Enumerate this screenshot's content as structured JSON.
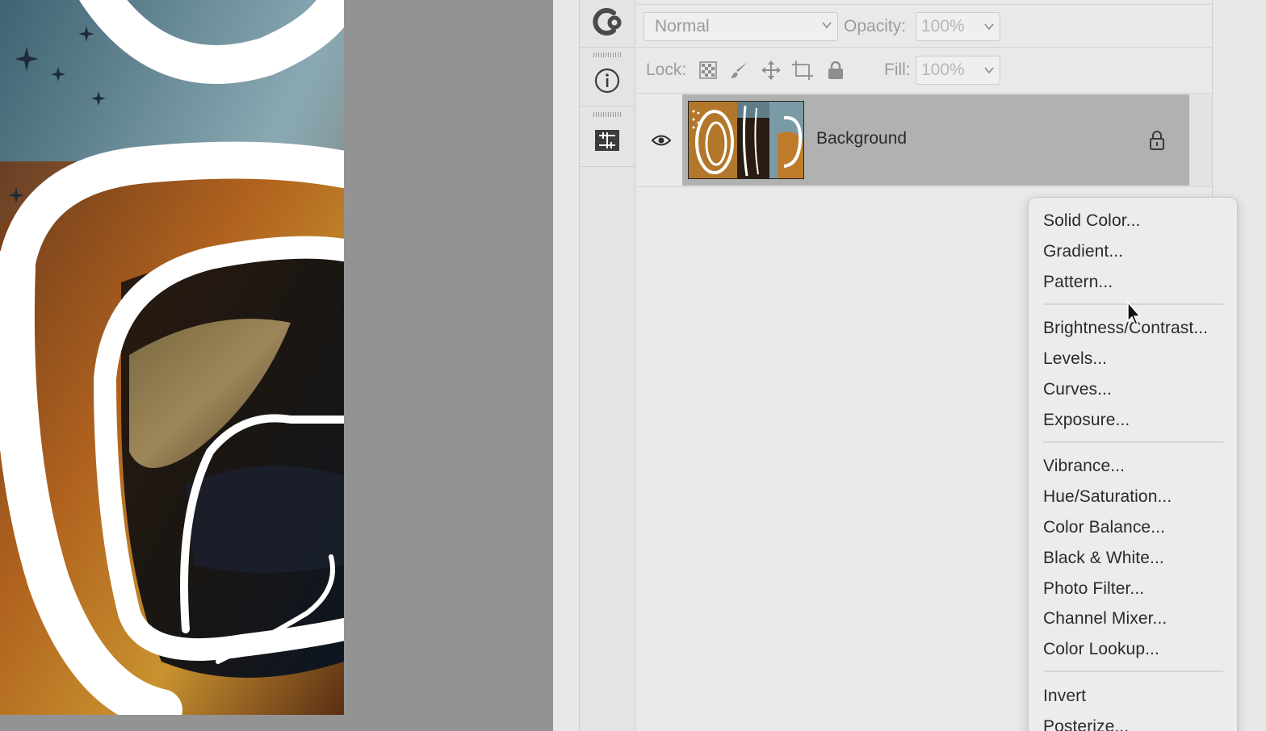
{
  "layers_panel": {
    "blend_mode": "Normal",
    "opacity_label": "Opacity:",
    "opacity_value": "100%",
    "lock_label": "Lock:",
    "fill_label": "Fill:",
    "fill_value": "100%",
    "layers": [
      {
        "name": "Background",
        "visible": true,
        "locked": true,
        "selected": true
      }
    ]
  },
  "context_menu": {
    "groups": [
      [
        "Solid Color...",
        "Gradient...",
        "Pattern..."
      ],
      [
        "Brightness/Contrast...",
        "Levels...",
        "Curves...",
        "Exposure..."
      ],
      [
        "Vibrance...",
        "Hue/Saturation...",
        "Color Balance...",
        "Black & White...",
        "Photo Filter...",
        "Channel Mixer...",
        "Color Lookup..."
      ],
      [
        "Invert",
        "Posterize..."
      ]
    ]
  },
  "icons": {
    "tool_1": "creative-cloud-libraries-icon",
    "tool_2": "info-icon",
    "tool_3": "properties-icon",
    "lock_icons": [
      "lock-transparent-pixels-icon",
      "lock-image-pixels-icon",
      "lock-position-icon",
      "lock-artboard-icon",
      "lock-all-icon"
    ],
    "layer_visibility": "eye-icon",
    "layer_lock": "lock-icon"
  },
  "colors": {
    "panel_bg": "#e9e9e9",
    "selected_layer": "#b1b1b1",
    "canvas_bg": "#939393",
    "menu_bg": "#ececec"
  }
}
